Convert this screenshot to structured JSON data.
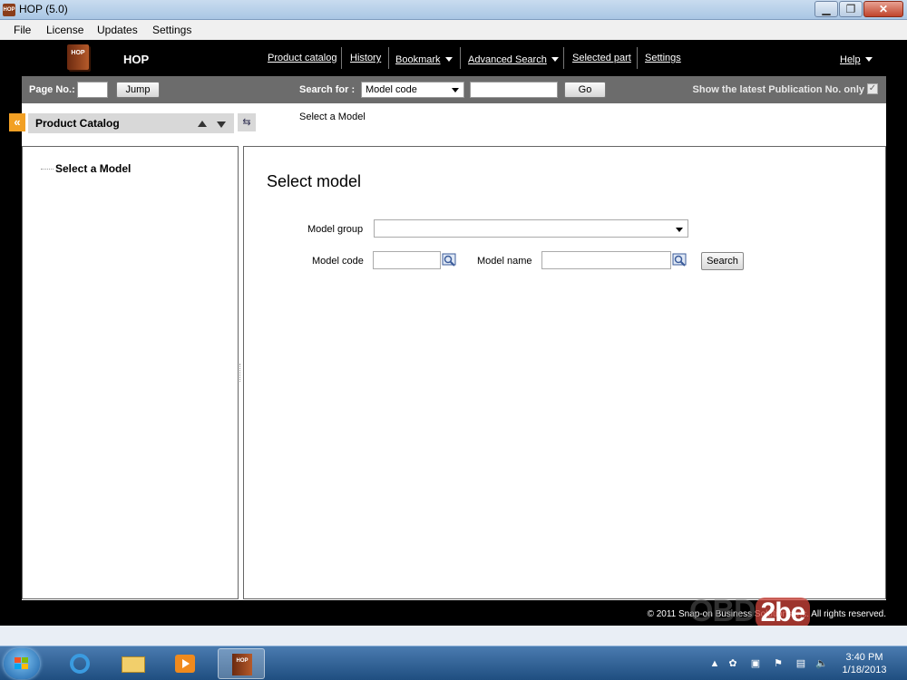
{
  "window": {
    "title": "HOP (5.0)",
    "icon_label": "HOP"
  },
  "menubar": [
    "File",
    "License",
    "Updates",
    "Settings"
  ],
  "header": {
    "brand": "HOP",
    "nav": [
      {
        "label": "Product catalog"
      },
      {
        "label": "History"
      },
      {
        "label": "Bookmark"
      },
      {
        "label": "Advanced Search"
      },
      {
        "label": "Selected part"
      },
      {
        "label": "Settings"
      }
    ],
    "help": "Help"
  },
  "toolbar": {
    "page_no_label": "Page No.:",
    "page_no_value": "",
    "jump_label": "Jump",
    "search_for_label": "Search for :",
    "search_type": "Model code",
    "search_value": "",
    "go_label": "Go",
    "latest_only_label": "Show the latest Publication No. only",
    "latest_only_checked": true
  },
  "left_panel": {
    "collapse_symbol": "«",
    "title": "Product Catalog",
    "sync_symbol": "⇆",
    "tree": [
      {
        "label": "Select a Model"
      }
    ]
  },
  "breadcrumb": "Select a Model",
  "main": {
    "heading": "Select model",
    "model_group_label": "Model group",
    "model_group_value": "",
    "model_code_label": "Model code",
    "model_code_value": "",
    "model_name_label": "Model name",
    "model_name_value": "",
    "search_label": "Search"
  },
  "footer": {
    "copyright": "© 2011 Snap-on Business Solutions Inc. All rights reserved."
  },
  "watermark": {
    "text": "OBD",
    "badge": "2be"
  },
  "taskbar": {
    "items": [
      "start-button",
      "internet-explorer-icon",
      "file-explorer-icon",
      "media-player-icon",
      "hop-app-icon"
    ],
    "time": "3:40 PM",
    "date": "1/18/2013"
  }
}
